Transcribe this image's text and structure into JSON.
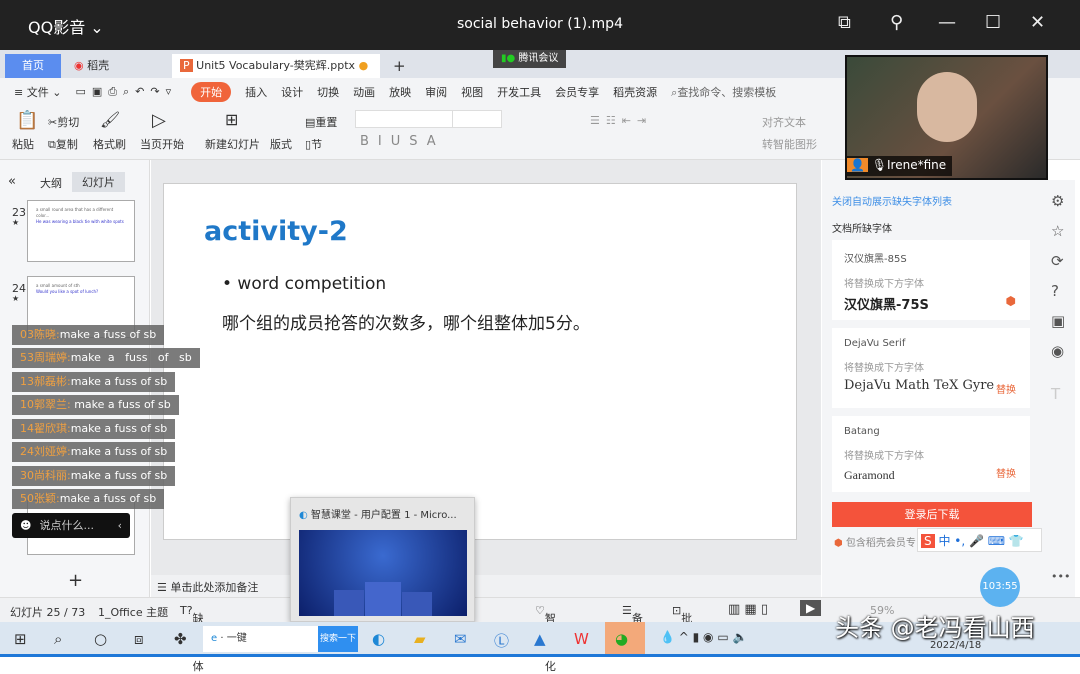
{
  "titlebar": {
    "app": "QQ影音 ⌄",
    "title": "social behavior (1).mp4"
  },
  "tabs": {
    "home": "首页",
    "daoke": "稻壳",
    "doc": "Unit5 Vocabulary-樊宪辉.pptx",
    "add": "+",
    "meeting": "腾讯会议"
  },
  "menu": {
    "file": "≡ 文件 ⌄",
    "items": [
      "开始",
      "插入",
      "设计",
      "切换",
      "动画",
      "放映",
      "审阅",
      "视图",
      "开发工具",
      "会员专享",
      "稻壳资源"
    ],
    "search": "查找命令、搜索模板"
  },
  "ribbon": {
    "paste": "粘贴",
    "cut": "剪切",
    "copy": "复制",
    "format_painter": "格式刷",
    "play_current": "当页开始",
    "new_slide": "新建幻灯片",
    "layout": "版式",
    "reset": "重置",
    "section": "节",
    "align_text": "对齐文本",
    "smartart": "转智能图形"
  },
  "leftpanel": {
    "tab_outline": "大纲",
    "tab_slides": "幻灯片",
    "collapse": "«",
    "add": "+",
    "thumbs": [
      {
        "num": "23",
        "star": "★"
      },
      {
        "num": "24",
        "star": "★"
      }
    ]
  },
  "slide": {
    "title": "activity-2",
    "bullet": "• word competition",
    "body": "哪个组的成员抢答的次数多，哪个组整体加5分。",
    "accent": "#1f78c8"
  },
  "notes": {
    "placeholder": "单击此处添加备注"
  },
  "status": {
    "slide_count": "幻灯片 25 / 73",
    "theme": "1_Office 主题",
    "missing_font": "缺失字体",
    "beautify": "智能美化",
    "notes": "备注",
    "comment": "批注",
    "zoom": "59%"
  },
  "chat": {
    "messages": [
      {
        "name": "03陈晓:",
        "text": "make a fuss of sb"
      },
      {
        "name": "53周瑞婷:",
        "text": "make  a   fuss   of   sb"
      },
      {
        "name": "13郝磊彬:",
        "text": "make a fuss of sb"
      },
      {
        "name": "10郭翠兰:",
        "text": " make a fuss of sb"
      },
      {
        "name": "14翟欣琪:",
        "text": "make a fuss of sb"
      },
      {
        "name": "24刘娅婷:",
        "text": "make a fuss of sb"
      },
      {
        "name": "30尚科丽:",
        "text": "make a fuss of sb"
      },
      {
        "name": "50张颖:",
        "text": "make a fuss of sb"
      }
    ],
    "input_placeholder": "说点什么..."
  },
  "video": {
    "name": "Irene*fine"
  },
  "rightpanel": {
    "close_link": "关闭自动展示缺失字体列表",
    "section": "文档所缺字体",
    "cards": [
      {
        "missing": "汉仪旗黑-85S",
        "hint": "将替换成下方字体",
        "replacement": "汉仪旗黑-75S",
        "action": ""
      },
      {
        "missing": "DejaVu Serif",
        "hint": "将替换成下方字体",
        "replacement": "DejaVu Math TeX Gyre",
        "action": "替换"
      },
      {
        "missing": "Batang",
        "hint": "将替换成下方字体",
        "replacement": "Garamond",
        "action": "替换"
      }
    ],
    "download": "登录后下载",
    "member_note": "包含稻壳会员专"
  },
  "popup": {
    "title": "智慧课堂 - 用户配置 1 - Micro..."
  },
  "timer": "103:55",
  "taskbar": {
    "search_text": "一键",
    "search_btn": "搜索一下",
    "date": "2022/4/18"
  },
  "watermark": "头条 @老冯看山西"
}
